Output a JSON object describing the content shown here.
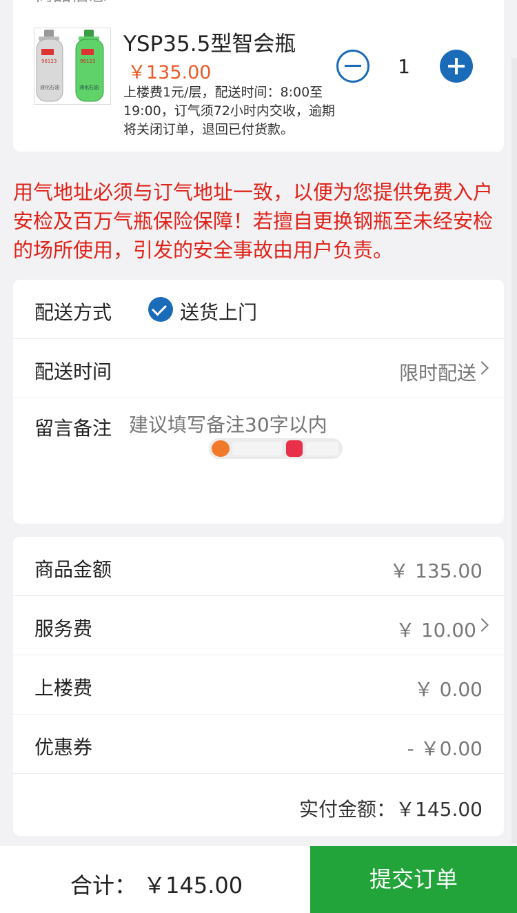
{
  "product_section": {
    "title": "商品信息",
    "product": {
      "name": "YSP35.5型智会瓶",
      "price": "￥135.00",
      "description": "上楼费1元/层，配送时间：8:00至19:00，订气须72小时内交收，逾期将关闭订单，退回已付货款。",
      "quantity": "1",
      "image": {
        "cylinder_left": {
          "color": "#d9d9d9",
          "label": "液化石油气",
          "phone": "96123",
          "brand": "奋泉"
        },
        "cylinder_right": {
          "color": "#5fd26a",
          "label": "液化石油气",
          "phone": "96123",
          "brand": "奋泉"
        }
      }
    }
  },
  "warning_text": "用气地址必须与订气地址一致，以便为您提供免费入户安检及百万气瓶保险保障！若擅自更换钢瓶至未经安检的场所使用，引发的安全事故由用户负责。",
  "delivery": {
    "method_label": "配送方式",
    "method_value": "送货上门",
    "time_label": "配送时间",
    "time_value": "限时配送",
    "note_label": "留言备注",
    "note_placeholder": "建议填写备注30字以内"
  },
  "fees": {
    "items": [
      {
        "label": "商品金额",
        "value": "￥ 135.00"
      },
      {
        "label": "服务费",
        "value": "￥ 10.00"
      },
      {
        "label": "上楼费",
        "value": "￥ 0.00"
      },
      {
        "label": "优惠券",
        "value": "- ￥0.00"
      }
    ],
    "total": "实付金额：￥145.00"
  },
  "bottom_bar": {
    "sum": "合计： ￥145.00",
    "submit_label": "提交订单"
  },
  "colors": {
    "accent_blue": "#1a6bb8",
    "price_orange": "#ef5a28",
    "warning_red": "#e0231a",
    "submit_green": "#23a43a"
  }
}
